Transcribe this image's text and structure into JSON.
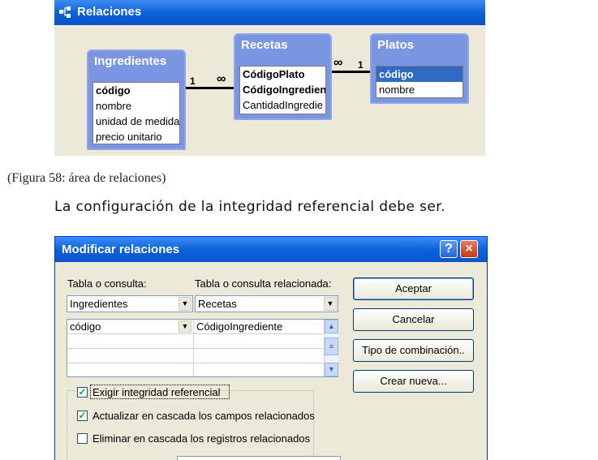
{
  "relations_window": {
    "title": "Relaciones",
    "tables": [
      {
        "title": "Ingredientes",
        "fields": [
          "código",
          "nombre",
          "unidad de medida",
          "precio unitario"
        ],
        "key_fields": [
          0
        ]
      },
      {
        "title": "Recetas",
        "fields": [
          "CódigoPlato",
          "CódigoIngredient",
          "CantidadIngredie"
        ],
        "key_fields": [
          0,
          1
        ]
      },
      {
        "title": "Platos",
        "fields": [
          "código",
          "nombre"
        ],
        "key_fields": [
          0
        ],
        "selected_field": 0
      }
    ],
    "relations": [
      {
        "from_label": "1",
        "to_label": "∞"
      },
      {
        "from_label": "∞",
        "to_label": "1"
      }
    ]
  },
  "caption": "(Figura 58: área de relaciones)",
  "body_text": "La configuración de la integridad referencial debe ser.",
  "dialog": {
    "title": "Modificar relaciones",
    "help_label": "?",
    "close_label": "×",
    "table_label": "Tabla o consulta:",
    "related_label": "Tabla o consulta relacionada:",
    "table_value": "Ingredientes",
    "related_value": "Recetas",
    "grid_rows": [
      [
        "código",
        "CódigoIngrediente"
      ],
      [
        "",
        ""
      ],
      [
        "",
        ""
      ],
      [
        "",
        ""
      ]
    ],
    "buttons": {
      "accept": "Aceptar",
      "cancel": "Cancelar",
      "join_type": "Tipo de combinación..",
      "create_new": "Crear nueva..."
    },
    "checks": [
      {
        "label": "Exigir integridad referencial",
        "checked": true
      },
      {
        "label": "Actualizar en cascada los campos relacionados",
        "checked": true
      },
      {
        "label": "Eliminar en cascada los registros relacionados",
        "checked": false
      }
    ]
  }
}
